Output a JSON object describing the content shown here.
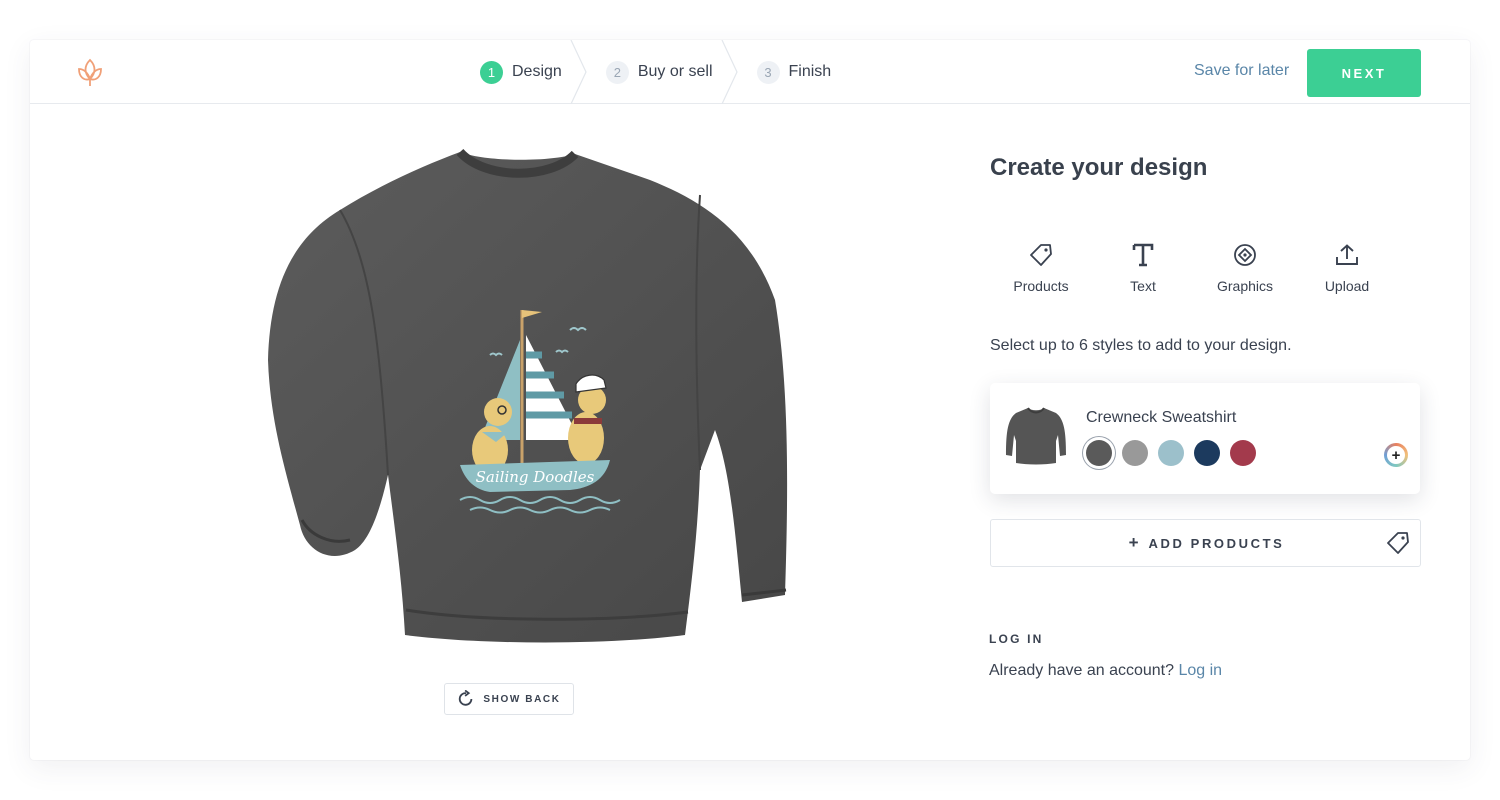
{
  "steps": [
    {
      "num": "1",
      "label": "Design",
      "active": true
    },
    {
      "num": "2",
      "label": "Buy or sell",
      "active": false
    },
    {
      "num": "3",
      "label": "Finish",
      "active": false
    }
  ],
  "header": {
    "save_label": "Save for later",
    "next_label": "NEXT"
  },
  "preview": {
    "show_back_label": "SHOW BACK"
  },
  "panel": {
    "title": "Create your design",
    "tools": [
      {
        "label": "Products",
        "icon": "tag-icon"
      },
      {
        "label": "Text",
        "icon": "text-icon"
      },
      {
        "label": "Graphics",
        "icon": "graphics-icon"
      },
      {
        "label": "Upload",
        "icon": "upload-icon"
      }
    ],
    "hint": "Select up to 6 styles to add to your design.",
    "product": {
      "name": "Crewneck Sweatshirt",
      "colors": [
        "#5a5a5a",
        "#999999",
        "#9cc0cb",
        "#1c3a5e",
        "#a33a4c"
      ],
      "selected_color_index": 0
    },
    "add_products_label": "ADD PRODUCTS",
    "login": {
      "heading": "LOG IN",
      "prompt": "Already have an account?",
      "link": "Log in"
    }
  },
  "colors": {
    "accent": "#3ccf94",
    "link": "#5a86a8",
    "logo": "#f0a078",
    "text": "#3a4250"
  }
}
